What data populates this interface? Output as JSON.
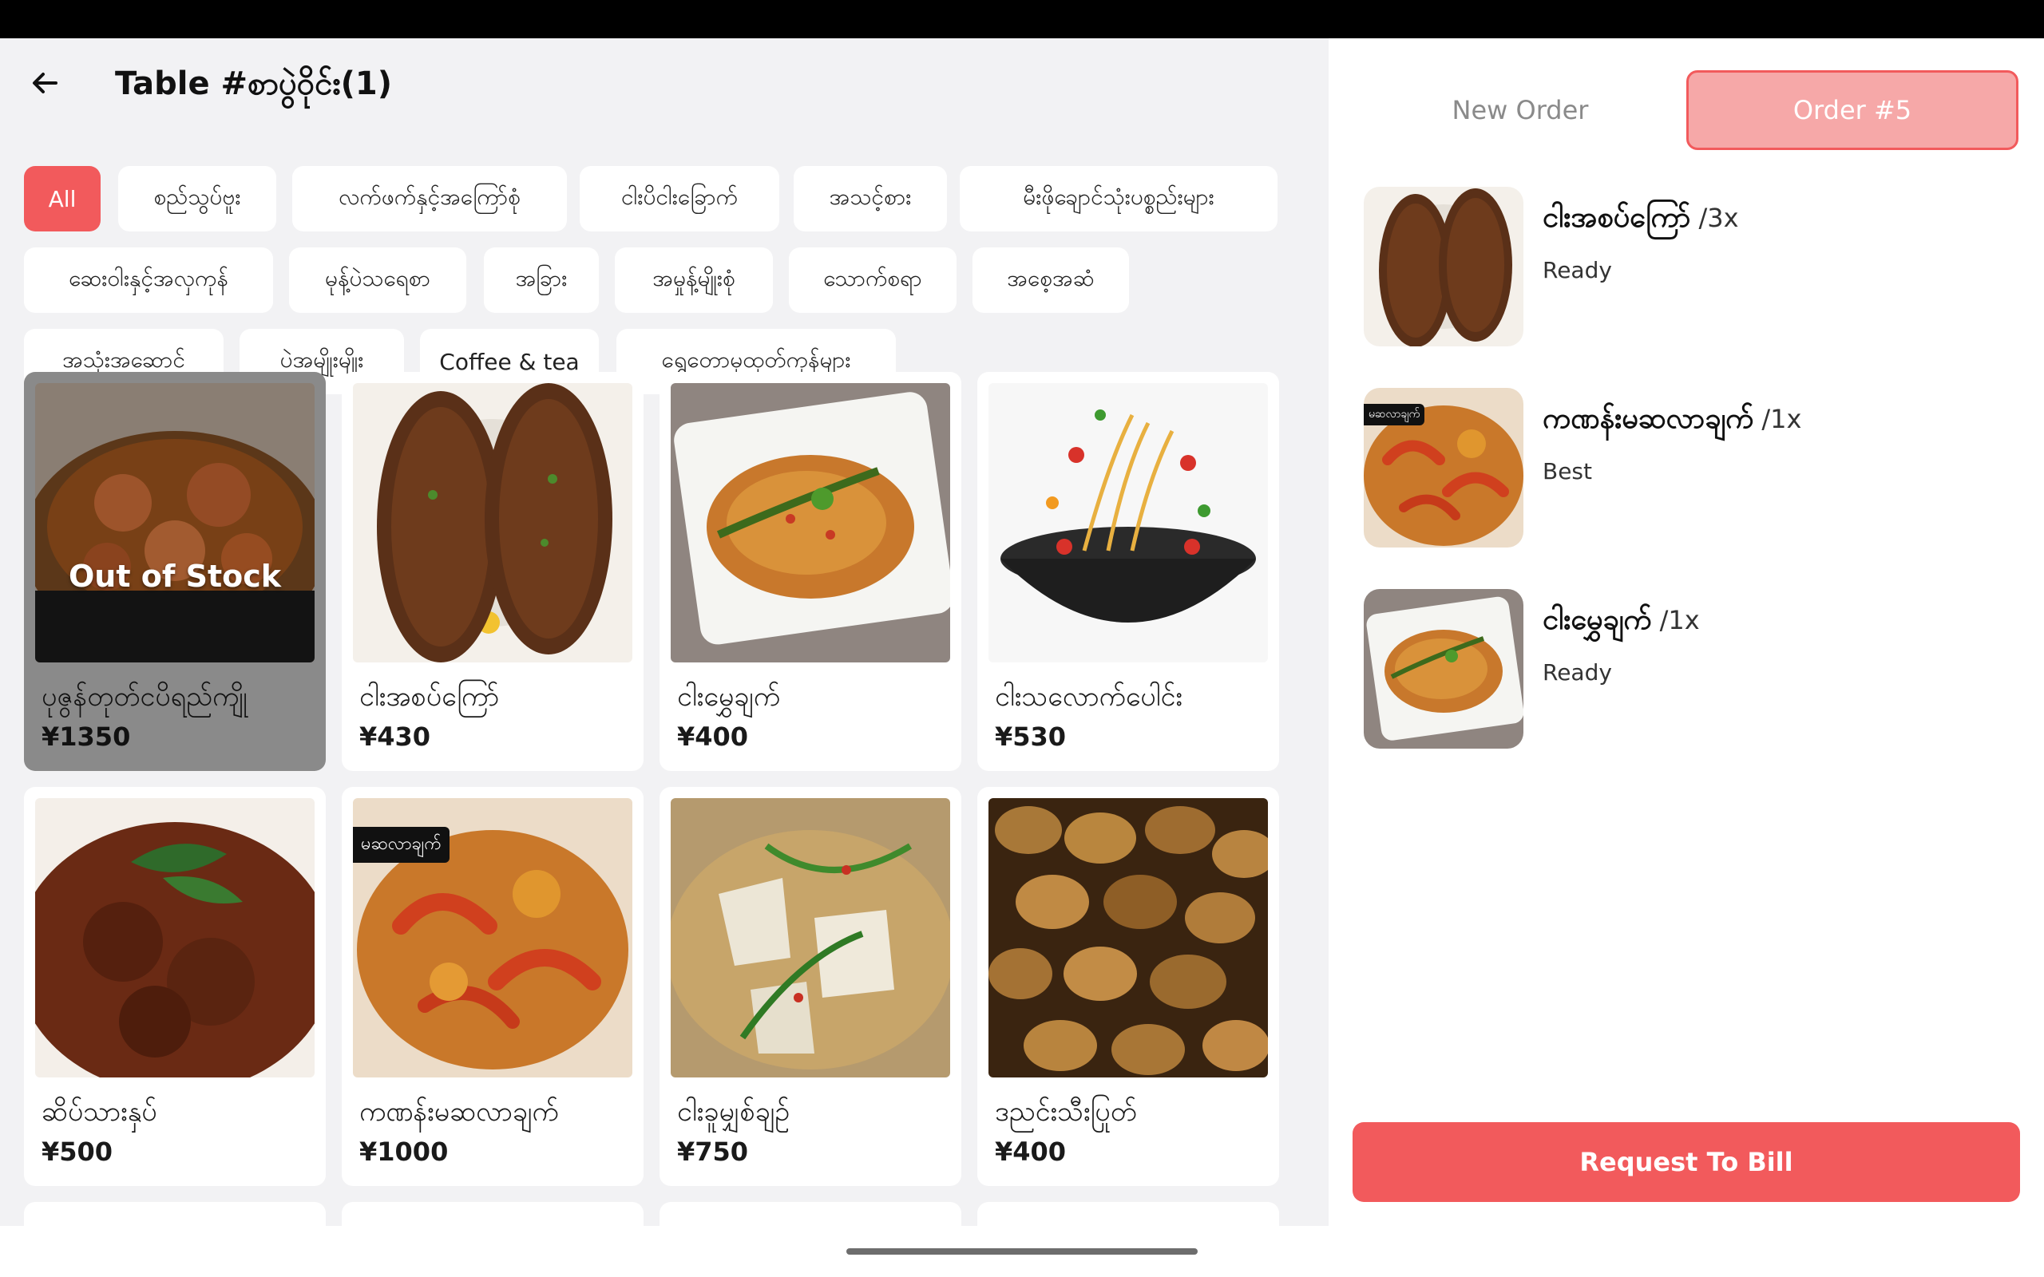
{
  "header": {
    "title": "Table #စာပွဲဝိုင်း(1)",
    "back_icon": "arrow-left-icon"
  },
  "categories": [
    {
      "label": "All",
      "active": true
    },
    {
      "label": "စည်သွပ်ဗူး"
    },
    {
      "label": "လက်ဖက်နှင့်အကြော်စုံ"
    },
    {
      "label": "ငါးပိငါးခြောက်"
    },
    {
      "label": "အသင့်စား"
    },
    {
      "label": "မီးဖိုချောင်သုံးပစ္စည်းများ"
    },
    {
      "label": "ဆေးဝါးနှင့်အလှကုန်"
    },
    {
      "label": "မုန့်ပဲသရေစာ"
    },
    {
      "label": "အခြား"
    },
    {
      "label": "အမှုန့်မျိုးစုံ"
    },
    {
      "label": "သောက်စရာ"
    },
    {
      "label": "အစေ့အဆံ"
    },
    {
      "label": "အသုံးအဆောင်"
    },
    {
      "label": "ပဲအမျိုးမျိုး"
    },
    {
      "label": "Coffee & tea"
    },
    {
      "label": "ရွှေတောမှထုတ်ကုန်များ"
    }
  ],
  "products": [
    {
      "name": "ပုဇွန်တုတ်ငပိရည်ကျို",
      "price": "¥1350",
      "status": "Out of Stock",
      "image": "prawn-curry"
    },
    {
      "name": "ငါးအစပ်ကြော်",
      "price": "¥430",
      "image": "fried-fish"
    },
    {
      "name": "ငါးမွှေချက်",
      "price": "¥400",
      "image": "fish-stirfry"
    },
    {
      "name": "ငါးသလောက်ပေါင်း",
      "price": "¥530",
      "image": "noodle-bowl"
    },
    {
      "name": "ဆိပ်သားနှပ်",
      "price": "¥500",
      "image": "goat-curry"
    },
    {
      "name": "ကဏန်းမဆလာချက်",
      "price": "¥1000",
      "image": "crab-masala",
      "tag": "မဆလာချက်"
    },
    {
      "name": "ငါးခူမျှစ်ချဉ်",
      "price": "¥750",
      "image": "fish-bamboo"
    },
    {
      "name": "ဒညင်းသီးပြုတ်",
      "price": "¥400",
      "image": "djenkol-beans"
    }
  ],
  "order_panel": {
    "tab_new": "New Order",
    "tab_current": "Order #5",
    "items": [
      {
        "name": "ငါးအစပ်ကြော်",
        "qty": "/3x",
        "status": "Ready",
        "image": "fried-fish"
      },
      {
        "name": "ကဏန်းမဆလာချက်",
        "qty": "/1x",
        "status": "Best",
        "image": "crab-masala",
        "tag": "မဆလာချက်"
      },
      {
        "name": "ငါးမွှေချက်",
        "qty": "/1x",
        "status": "Ready",
        "image": "fish-stirfry"
      }
    ],
    "bill_button": "Request To Bill"
  },
  "colors": {
    "accent": "#f25a5c",
    "accent_light": "#f6a8a8",
    "background": "#f2f2f4",
    "oos_card": "#8a8a8a"
  }
}
